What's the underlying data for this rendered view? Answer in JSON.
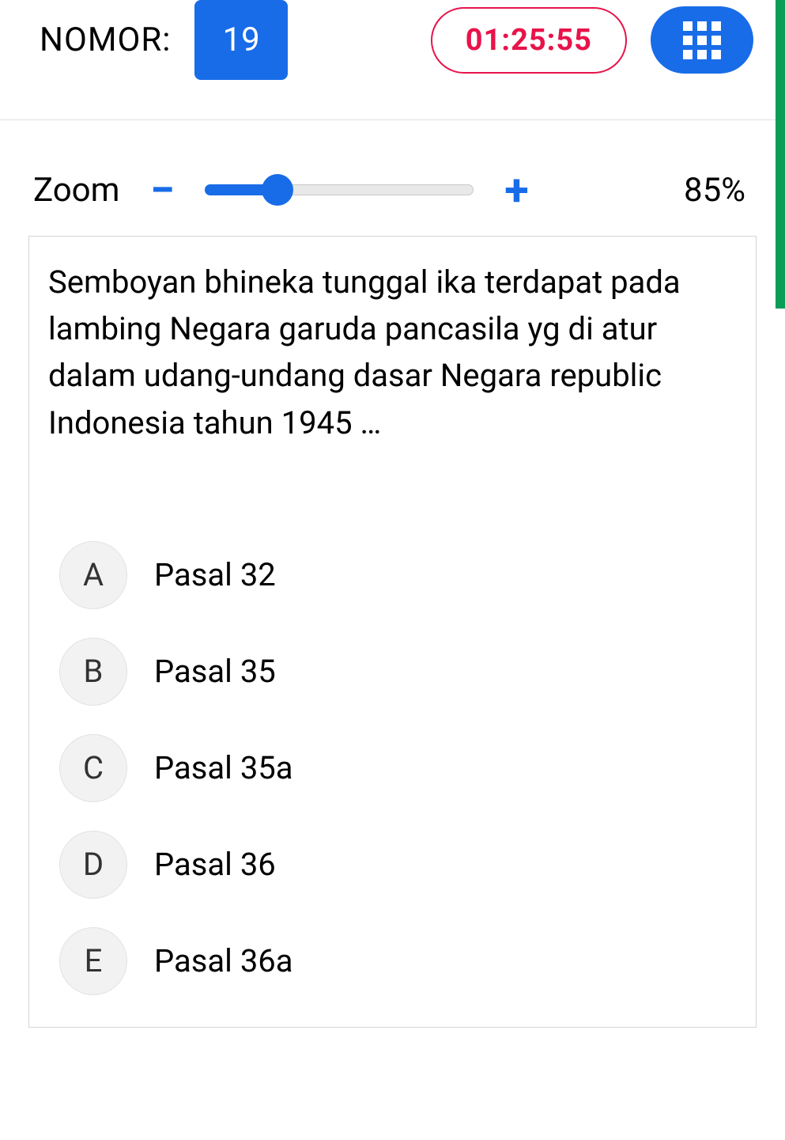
{
  "header": {
    "nomor_label": "NOMOR:",
    "nomor_value": "19",
    "timer": "01:25:55"
  },
  "zoom": {
    "label": "Zoom",
    "minus": "−",
    "plus": "+",
    "value": "85%",
    "percent": 27
  },
  "question": {
    "text": "Semboyan bhineka tunggal ika terdapat pada lambing Negara garuda pancasila yg di atur dalam udang-undang dasar Negara republic Indonesia tahun 1945 …"
  },
  "options": [
    {
      "letter": "A",
      "text": "Pasal 32"
    },
    {
      "letter": "B",
      "text": "Pasal 35"
    },
    {
      "letter": "C",
      "text": "Pasal 35a"
    },
    {
      "letter": "D",
      "text": "Pasal 36"
    },
    {
      "letter": "E",
      "text": "Pasal 36a"
    }
  ]
}
